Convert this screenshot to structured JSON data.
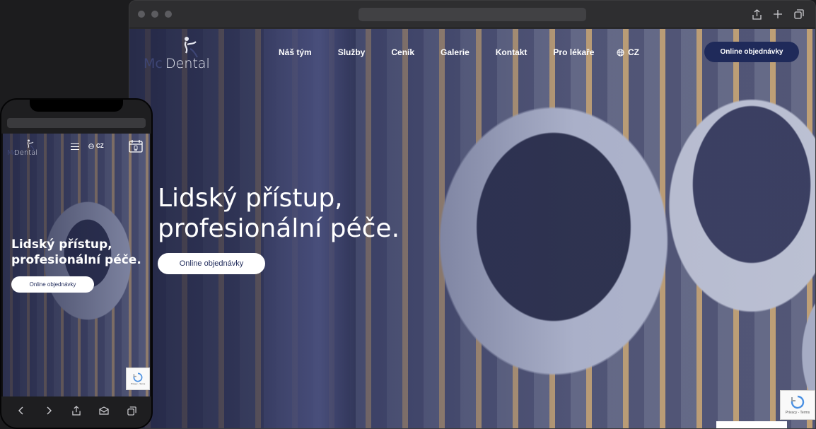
{
  "brand": {
    "mc": "Mc",
    "dental": "Dental"
  },
  "nav": {
    "items": [
      "Náš tým",
      "Služby",
      "Ceník",
      "Galerie",
      "Kontakt",
      "Pro lékaře"
    ],
    "lang": "CZ",
    "cta": "Online objednávky"
  },
  "hero": {
    "line1": "Lidský přístup,",
    "line2": "profesionální péče.",
    "cta": "Online objednávky"
  },
  "recaptcha": {
    "text": "Privacy - Terms"
  },
  "colors": {
    "navy": "#1f2a5a",
    "white": "#ffffff"
  },
  "icons": {
    "browser": [
      "share-icon",
      "new-tab-icon",
      "tabs-icon"
    ],
    "phone": [
      "back-icon",
      "forward-icon",
      "share-icon",
      "bookmarks-icon",
      "tabs-icon"
    ]
  }
}
